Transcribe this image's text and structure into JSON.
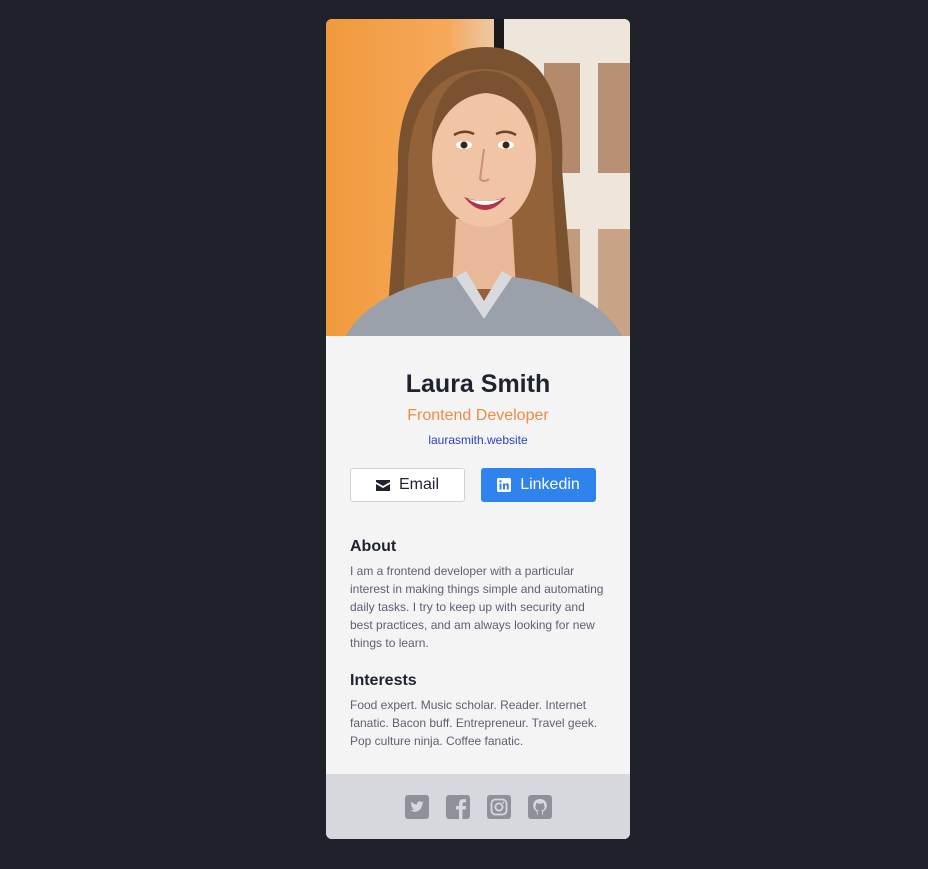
{
  "profile": {
    "name": "Laura Smith",
    "role": "Frontend Developer",
    "website": "laurasmith.website"
  },
  "buttons": {
    "email_label": "Email",
    "email_icon": "mail-icon",
    "linkedin_label": "Linkedin",
    "linkedin_icon": "linkedin-icon"
  },
  "about": {
    "heading": "About",
    "text": "I am a frontend developer with a particular interest in making things simple and automating daily tasks. I try to keep up with security and best practices, and am always looking for new things to learn."
  },
  "interests": {
    "heading": "Interests",
    "text": "Food expert. Music scholar. Reader. Internet fanatic. Bacon buff. Entrepreneur. Travel geek. Pop culture ninja. Coffee fanatic."
  },
  "footer": {
    "icons": [
      "twitter-icon",
      "facebook-icon",
      "instagram-icon",
      "github-icon"
    ]
  },
  "colors": {
    "background": "#1f222b",
    "card": "#f4f4f5",
    "accent_role": "#f08a47",
    "link": "#2b3fc9",
    "linkedin_button": "#2e83ec",
    "footer": "#d7d8dd",
    "footer_icon": "#8f909a"
  }
}
